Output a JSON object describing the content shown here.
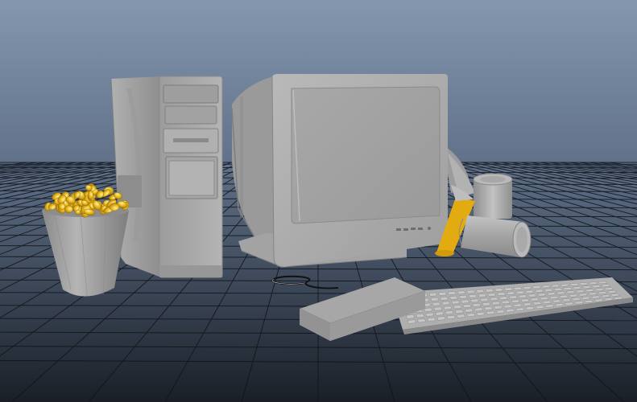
{
  "viewport": {
    "background_top": "#7f93ab",
    "background_mid": "#5c6d84",
    "background_bottom": "#1c2129",
    "grid_color": "#0d1014"
  },
  "scene": {
    "objects": [
      {
        "name": "popcorn-bucket",
        "popcorn_color": "#e8b81c",
        "bucket_color": "#9c9c9c"
      },
      {
        "name": "computer-tower",
        "color": "#a7a7a7"
      },
      {
        "name": "crt-monitor",
        "color": "#a9a9a9"
      },
      {
        "name": "soda-cans",
        "color": "#a5a5a5",
        "spill_color": "#e5ad14"
      },
      {
        "name": "mouse",
        "color": "#a0a0a0"
      },
      {
        "name": "keyboard",
        "color": "#b0b0b0"
      },
      {
        "name": "cable",
        "color": "#1a1a1a"
      }
    ]
  }
}
